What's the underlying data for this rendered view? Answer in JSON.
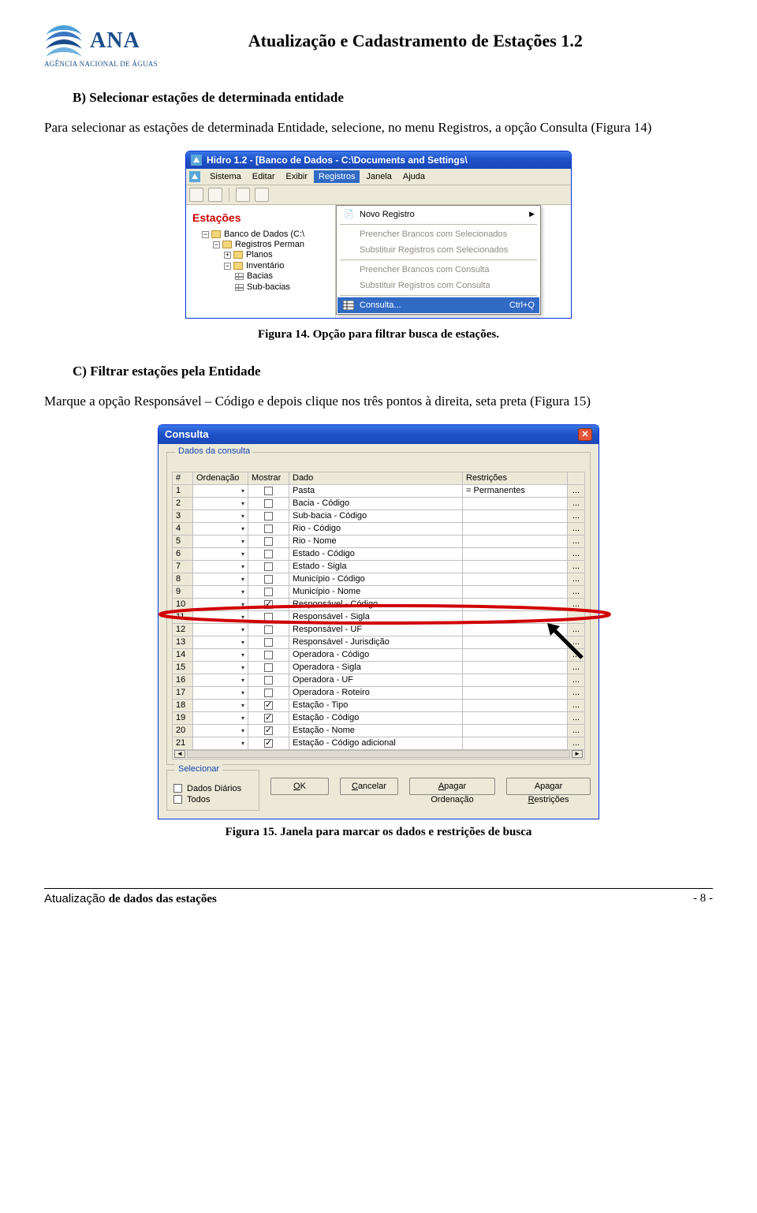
{
  "header": {
    "logo_text": "ANA",
    "logo_sub": "AGÊNCIA NACIONAL DE ÁGUAS",
    "doc_title": "Atualização e Cadastramento de Estações 1.2"
  },
  "body": {
    "section_b_title": "B) Selecionar estações de determinada entidade",
    "section_b_text": "Para selecionar as estações de determinada Entidade, selecione, no menu Registros, a opção Consulta (Figura 14)",
    "fig14_caption": "Figura 14. Opção para filtrar busca de estações.",
    "section_c_title": "C) Filtrar estações pela Entidade",
    "section_c_text": "Marque a opção Responsável – Código e depois clique nos três pontos à direita, seta preta (Figura 15)",
    "fig15_caption": "Figura 15. Janela para marcar os dados e restrições de busca"
  },
  "win1": {
    "title": "Hidro 1.2  - [Banco de Dados - C:\\Documents and Settings\\",
    "menus": {
      "sistema": "Sistema",
      "editar": "Editar",
      "exibir": "Exibir",
      "registros": "Registros",
      "janela": "Janela",
      "ajuda": "Ajuda"
    },
    "tree_title": "Estações",
    "tree": {
      "root": "Banco de Dados (C:\\",
      "n1": "Registros Perman",
      "n2": "Planos",
      "n3": "Inventário",
      "n4": "Bacias",
      "n5": "Sub-bacias"
    },
    "dd": {
      "novo": "Novo Registro",
      "preencher_sel": "Preencher Brancos com Selecionados",
      "subs_sel": "Substituir Registros com Selecionados",
      "preencher_con": "Preencher Brancos com Consulta",
      "subs_con": "Substituir Registros com Consulta",
      "consulta": "Consulta...",
      "shortcut": "Ctrl+Q"
    }
  },
  "dlg": {
    "title": "Consulta",
    "group": "Dados da consulta",
    "headers": {
      "num": "#",
      "ord": "Ordenação",
      "mos": "Mostrar",
      "dado": "Dado",
      "rest": "Restrições"
    },
    "rows": [
      {
        "n": "1",
        "dado": "Pasta",
        "rest": "= Permanentes",
        "chk": false
      },
      {
        "n": "2",
        "dado": "Bacia - Código",
        "rest": "",
        "chk": false
      },
      {
        "n": "3",
        "dado": "Sub-bacia - Código",
        "rest": "",
        "chk": false
      },
      {
        "n": "4",
        "dado": "Rio - Código",
        "rest": "",
        "chk": false
      },
      {
        "n": "5",
        "dado": "Rio - Nome",
        "rest": "",
        "chk": false
      },
      {
        "n": "6",
        "dado": "Estado - Código",
        "rest": "",
        "chk": false
      },
      {
        "n": "7",
        "dado": "Estado - Sigla",
        "rest": "",
        "chk": false
      },
      {
        "n": "8",
        "dado": "Município - Código",
        "rest": "",
        "chk": false
      },
      {
        "n": "9",
        "dado": "Município - Nome",
        "rest": "",
        "chk": false
      },
      {
        "n": "10",
        "dado": "Responsável - Código",
        "rest": "",
        "chk": true
      },
      {
        "n": "11",
        "dado": "Responsável - Sigla",
        "rest": "",
        "chk": false
      },
      {
        "n": "12",
        "dado": "Responsável - UF",
        "rest": "",
        "chk": false
      },
      {
        "n": "13",
        "dado": "Responsável - Jurisdição",
        "rest": "",
        "chk": false
      },
      {
        "n": "14",
        "dado": "Operadora - Código",
        "rest": "",
        "chk": false
      },
      {
        "n": "15",
        "dado": "Operadora - Sigla",
        "rest": "",
        "chk": false
      },
      {
        "n": "16",
        "dado": "Operadora - UF",
        "rest": "",
        "chk": false
      },
      {
        "n": "17",
        "dado": "Operadora - Roteiro",
        "rest": "",
        "chk": false
      },
      {
        "n": "18",
        "dado": "Estação - Tipo",
        "rest": "",
        "chk": true
      },
      {
        "n": "19",
        "dado": "Estação - Código",
        "rest": "",
        "chk": true
      },
      {
        "n": "20",
        "dado": "Estação - Nome",
        "rest": "",
        "chk": true
      },
      {
        "n": "21",
        "dado": "Estação - Código adicional",
        "rest": "",
        "chk": true
      }
    ],
    "sel_label": "Selecionar",
    "sel_dd": "Dados Diários",
    "sel_todos": "Todos",
    "btn_ok": "OK",
    "btn_cancel": "Cancelar",
    "btn_clear_ord": "Apagar Ordenação",
    "btn_clear_rest": "Apagar Restrições"
  },
  "footer": {
    "left": "Atualização de dados das estações",
    "right": "- 8 -"
  }
}
